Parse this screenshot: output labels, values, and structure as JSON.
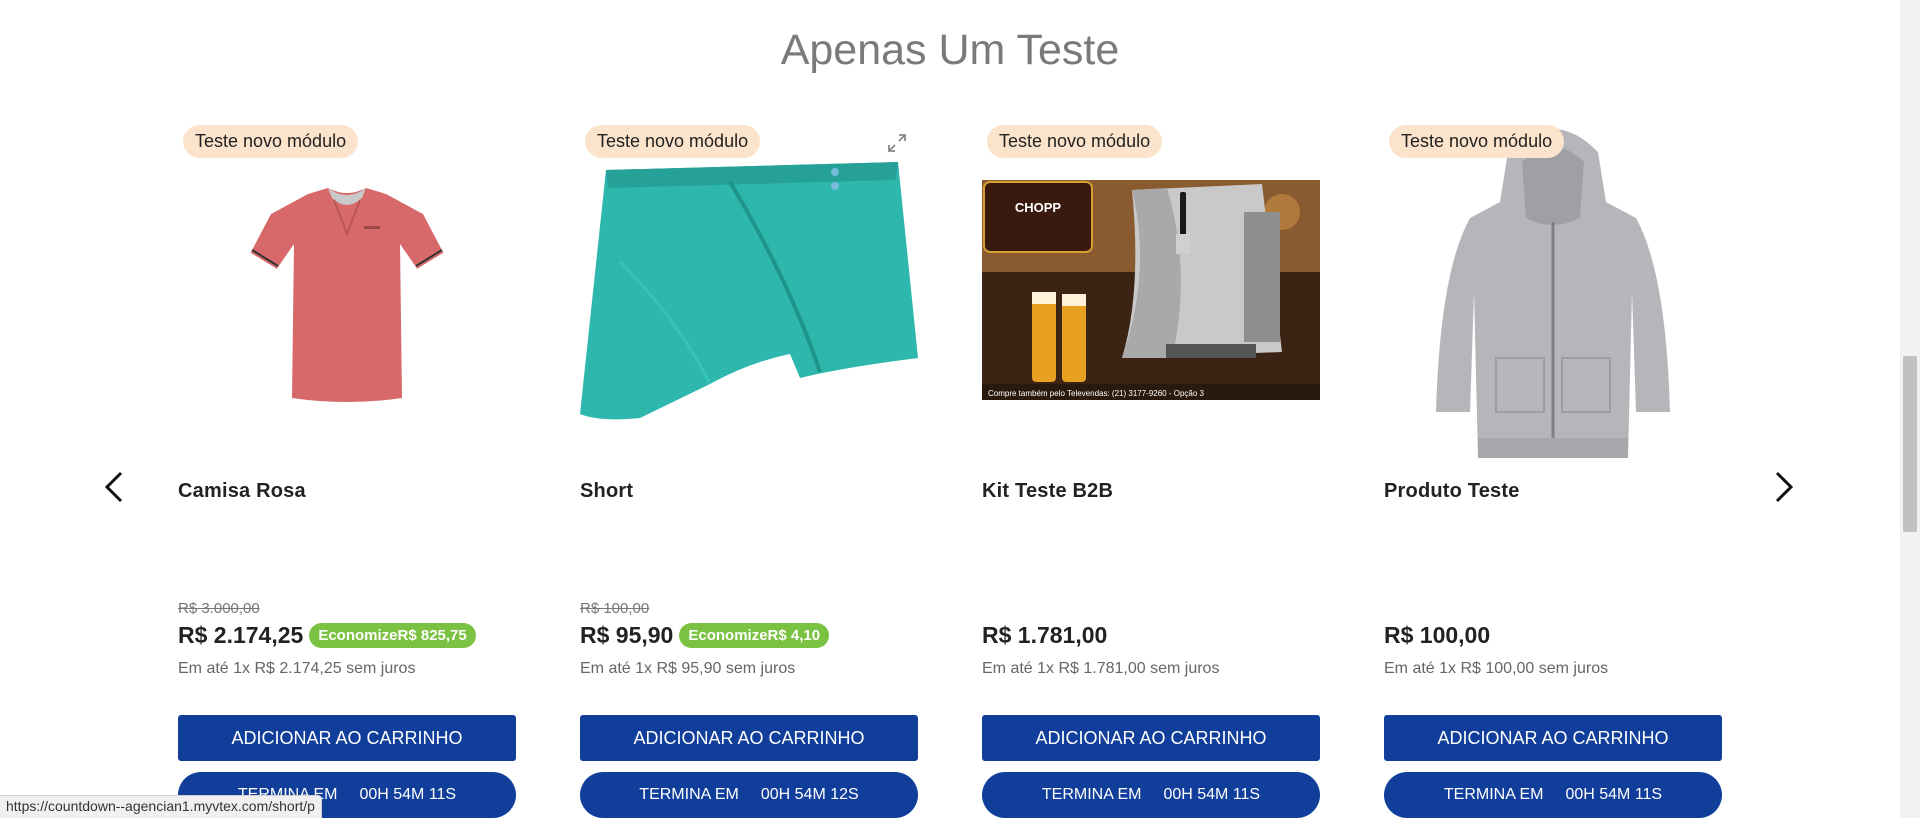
{
  "section": {
    "title": "Apenas Um Teste"
  },
  "carousel": {
    "prev_icon": "chevron-left-icon",
    "next_icon": "chevron-right-icon"
  },
  "products": [
    {
      "badge": "Teste novo módulo",
      "name": "Camisa Rosa",
      "old_price": "R$ 3.000,00",
      "price": "R$ 2.174,25",
      "savings": "EconomizeR$ 825,75",
      "installments": "Em até 1x R$ 2.174,25 sem juros",
      "add_to_cart": "ADICIONAR AO CARRINHO",
      "timer_label": "TERMINA EM",
      "timer_value": "00H 54M 11S",
      "image": "pink-polo-shirt"
    },
    {
      "badge": "Teste novo módulo",
      "name": "Short",
      "old_price": "R$ 100,00",
      "price": "R$ 95,90",
      "savings": "EconomizeR$ 4,10",
      "installments": "Em até 1x R$ 95,90 sem juros",
      "add_to_cart": "ADICIONAR AO CARRINHO",
      "timer_label": "TERMINA EM",
      "timer_value": "00H 54M 12S",
      "image": "teal-skort"
    },
    {
      "badge": "Teste novo módulo",
      "name": "Kit Teste B2B",
      "price": "R$ 1.781,00",
      "installments": "Em até 1x R$ 1.781,00 sem juros",
      "add_to_cart": "ADICIONAR AO CARRINHO",
      "timer_label": "TERMINA EM",
      "timer_value": "00H 54M 11S",
      "image": "chopp-beer-dispenser",
      "image_logo_text": "CHOPP",
      "image_caption": "Compre também pelo Televendas: (21) 3177-9260 - Opção 3"
    },
    {
      "badge": "Teste novo módulo",
      "name": "Produto Teste",
      "price": "R$ 100,00",
      "installments": "Em até 1x R$ 100,00 sem juros",
      "add_to_cart": "ADICIONAR AO CARRINHO",
      "timer_label": "TERMINA EM",
      "timer_value": "00H 54M 11S",
      "image": "gray-hoodie"
    }
  ],
  "status_bar": {
    "url": "https://countdown--agencian1.myvtex.com/short/p"
  },
  "colors": {
    "button": "#113e9b",
    "badge": "#fbe3cc",
    "savings": "#7cc242",
    "title": "#7a7a7a"
  }
}
